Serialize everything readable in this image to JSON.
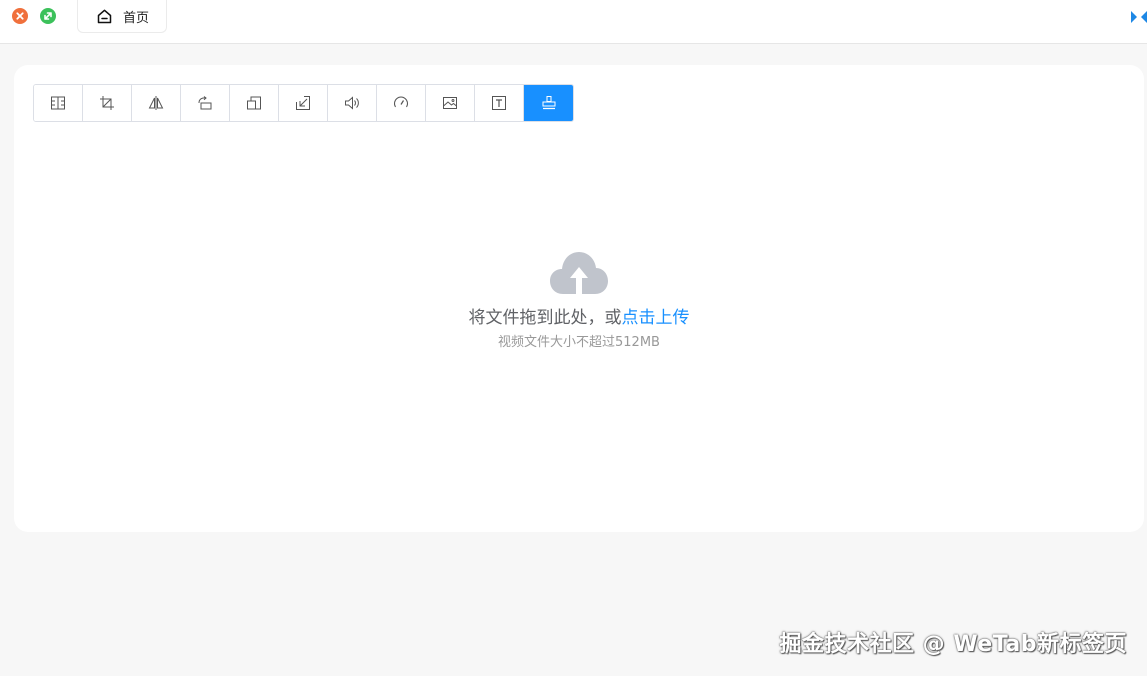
{
  "window": {
    "tab": {
      "label": "首页",
      "icon": "home-icon"
    }
  },
  "toolbar": {
    "tools": [
      {
        "icon": "split-icon"
      },
      {
        "icon": "crop-icon"
      },
      {
        "icon": "flip-icon"
      },
      {
        "icon": "rotate-icon"
      },
      {
        "icon": "resize-icon"
      },
      {
        "icon": "compress-icon"
      },
      {
        "icon": "volume-icon"
      },
      {
        "icon": "speed-icon"
      },
      {
        "icon": "image-icon"
      },
      {
        "icon": "text-icon"
      },
      {
        "icon": "stamp-icon",
        "active": true
      }
    ],
    "active_color": "#1890ff"
  },
  "upload": {
    "main_prefix": "将文件拖到此处，或",
    "main_link": "点击上传",
    "tip": "视频文件大小不超过512MB",
    "icon": "cloud-upload-icon"
  },
  "watermark": "掘金技术社区 @ WeTab新标签页"
}
